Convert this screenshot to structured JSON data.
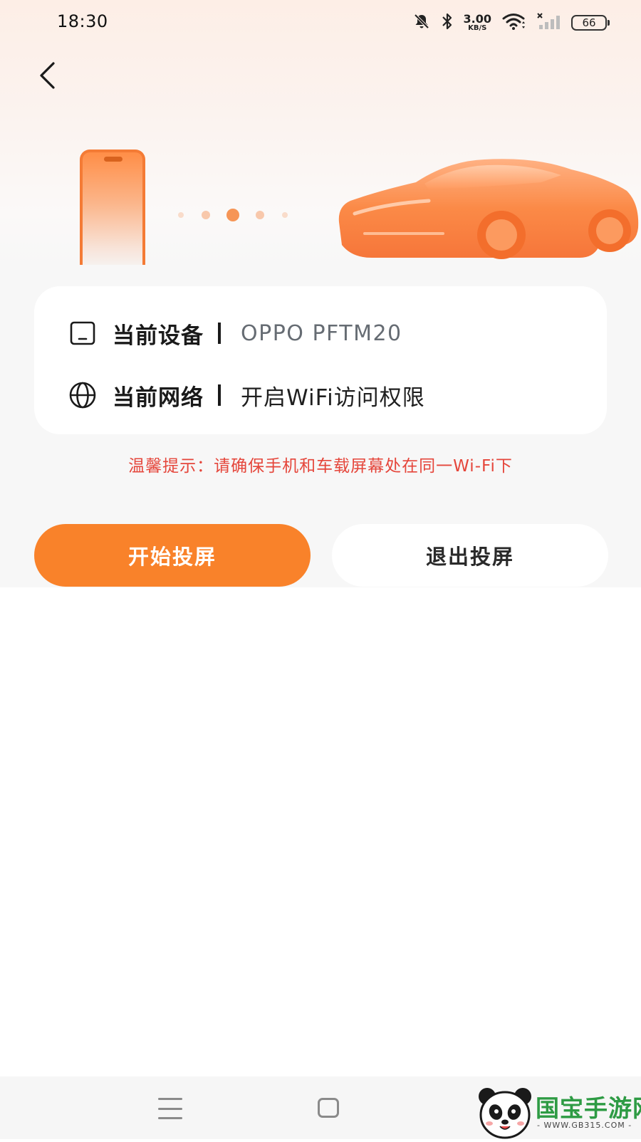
{
  "status_bar": {
    "time": "18:30",
    "net_speed": "3.00",
    "net_unit": "KB/S",
    "battery": "66",
    "icons": [
      "mute-icon",
      "bluetooth-icon",
      "wifi-icon",
      "cellular-no-signal-icon"
    ]
  },
  "header": {
    "back_icon": "chevron-left-icon"
  },
  "hero": {
    "illustration": "phone-to-car-casting",
    "accent_color": "#f9822a"
  },
  "info": {
    "device_label": "当前设备",
    "device_value": "OPPO PFTM20",
    "device_icon": "tablet-icon",
    "network_label": "当前网络",
    "network_value": "开启WiFi访问权限",
    "network_icon": "globe-icon"
  },
  "tip": "温馨提示：请确保手机和车载屏幕处在同一Wi-Fi下",
  "buttons": {
    "start": "开始投屏",
    "exit": "退出投屏"
  },
  "nav": {
    "menu_icon": "menu-icon",
    "home_icon": "home-icon"
  },
  "watermark": {
    "name": "国宝手游网",
    "url": "- WWW.GB315.COM -"
  },
  "colors": {
    "accent": "#f9822a",
    "tip": "#e5463b",
    "background": "#f7f7f7"
  }
}
